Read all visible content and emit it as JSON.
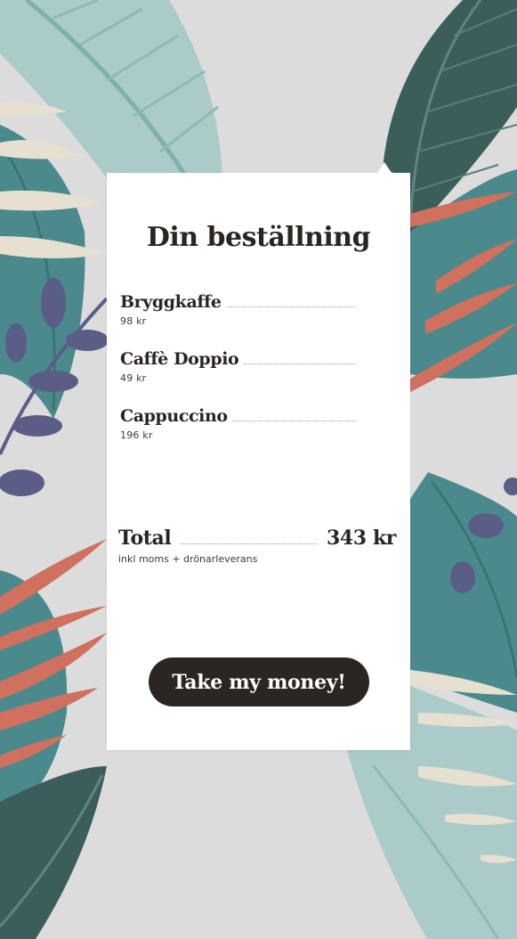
{
  "colors": {
    "background": "#dcdcdc",
    "card": "#ffffff",
    "text": "#2a2521",
    "button": "#2b2622",
    "leaf_teal": "#4a8a8c",
    "leaf_light": "#aacbc7",
    "leaf_dark": "#3b5e5b",
    "leaf_coral": "#d0705e",
    "leaf_cream": "#e6e0d1",
    "leaf_purple": "#5a5d86"
  },
  "order": {
    "title": "Din beställning",
    "items": [
      {
        "name": "Bryggkaffe",
        "price": "98 kr"
      },
      {
        "name": "Caffè Doppio",
        "price": "49 kr"
      },
      {
        "name": "Cappuccino",
        "price": "196 kr"
      }
    ],
    "total": {
      "label": "Total",
      "amount": "343 kr",
      "note": "inkl moms + drönarleverans"
    },
    "pay_button": "Take my money!"
  }
}
